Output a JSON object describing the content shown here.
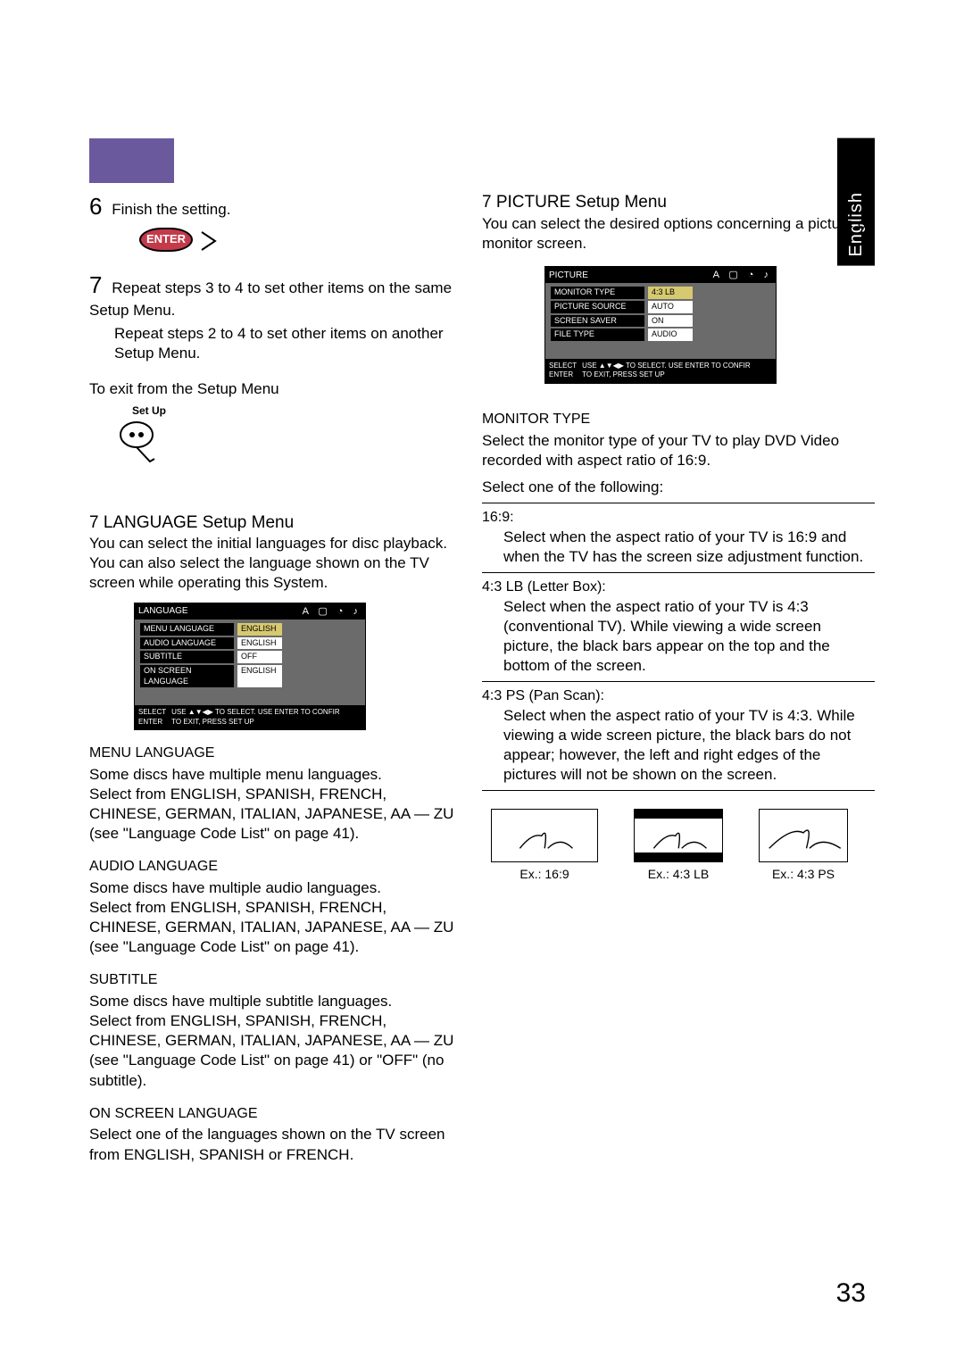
{
  "lang_tab": "English",
  "left": {
    "step6_num": "6",
    "step6_text": "Finish the setting.",
    "enter_label": "ENTER",
    "step7_num": "7",
    "step7_a": "Repeat steps 3 to 4 to set other items on the same Setup Menu.",
    "step7_b": "Repeat steps 2 to 4 to set other items on another Setup Menu.",
    "exit_heading": "To exit from the Setup Menu",
    "setup_label": "Set Up",
    "lang_heading_mark": "7",
    "lang_heading": "LANGUAGE Setup Menu",
    "lang_intro": "You can select the initial languages for disc playback. You can also select the language shown on the TV screen while operating this System.",
    "lang_menu": {
      "title": "LANGUAGE",
      "rows": [
        {
          "k": "MENU LANGUAGE",
          "v": "ENGLISH",
          "hl": true
        },
        {
          "k": "AUDIO LANGUAGE",
          "v": "ENGLISH",
          "hl": false
        },
        {
          "k": "SUBTITLE",
          "v": "OFF",
          "hl": false
        },
        {
          "k": "ON SCREEN LANGUAGE",
          "v": "ENGLISH",
          "hl": false
        }
      ],
      "hint_l": "SELECT\nENTER",
      "hint_r": "USE ▲▼◀▶ TO SELECT. USE ENTER TO CONFIR\nTO EXIT, PRESS SET UP"
    },
    "sections": {
      "menu_lang_h": "MENU LANGUAGE",
      "menu_lang_b": "Some discs have multiple menu languages.\nSelect from ENGLISH, SPANISH, FRENCH, CHINESE, GERMAN, ITALIAN, JAPANESE, AA — ZU (see \"Language Code List\" on page 41).",
      "audio_lang_h": "AUDIO LANGUAGE",
      "audio_lang_b": "Some discs have multiple audio languages.\nSelect from ENGLISH, SPANISH, FRENCH, CHINESE, GERMAN, ITALIAN, JAPANESE, AA — ZU (see \"Language Code List\" on page 41).",
      "subtitle_h": "SUBTITLE",
      "subtitle_b": "Some discs have multiple subtitle languages.\nSelect from ENGLISH, SPANISH, FRENCH, CHINESE, GERMAN, ITALIAN, JAPANESE, AA — ZU (see \"Language Code List\" on page 41) or \"OFF\" (no subtitle).",
      "osd_h": "ON SCREEN LANGUAGE",
      "osd_b": "Select one of the languages shown on the TV screen from ENGLISH, SPANISH or FRENCH."
    }
  },
  "right": {
    "pic_heading_mark": "7",
    "pic_heading": "PICTURE Setup Menu",
    "pic_intro": "You can select the desired options concerning a picture on monitor screen.",
    "pic_menu": {
      "title": "PICTURE",
      "rows": [
        {
          "k": "MONITOR TYPE",
          "v": "4:3 LB",
          "hl": true
        },
        {
          "k": "PICTURE SOURCE",
          "v": "AUTO",
          "hl": false
        },
        {
          "k": "SCREEN SAVER",
          "v": "ON",
          "hl": false
        },
        {
          "k": "FILE TYPE",
          "v": "AUDIO",
          "hl": false
        }
      ],
      "hint_l": "SELECT\nENTER",
      "hint_r": "USE ▲▼◀▶ TO SELECT. USE ENTER TO CONFIR\nTO EXIT, PRESS SET UP"
    },
    "mt_h": "MONITOR TYPE",
    "mt_intro": "Select the monitor type of your TV to play DVD Video recorded with aspect ratio of 16:9.",
    "mt_select": "Select one of the following:",
    "mt_items": [
      {
        "head": "16:9:",
        "body": "Select when the aspect ratio of your TV is 16:9 and when the TV has the screen size adjustment function."
      },
      {
        "head": "4:3 LB (Letter Box):",
        "body": "Select when the aspect ratio of your TV is 4:3 (conventional TV). While viewing a wide screen picture, the black bars appear on the top and the bottom of the screen."
      },
      {
        "head": "4:3 PS (Pan Scan):",
        "body": "Select when the aspect ratio of your TV is 4:3. While viewing a wide screen picture, the black bars do not appear; however, the left and right edges of the pictures will not be shown on the screen."
      }
    ],
    "ex_labels": {
      "a": "Ex.: 16:9",
      "b": "Ex.: 4:3 LB",
      "c": "Ex.: 4:3 PS"
    }
  },
  "page_number": "33"
}
